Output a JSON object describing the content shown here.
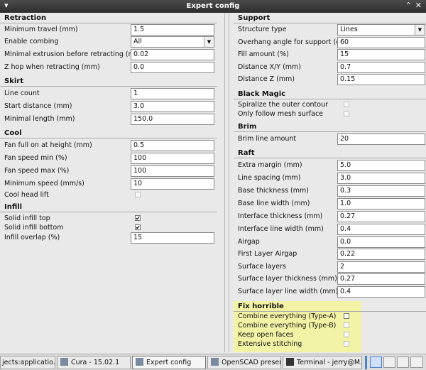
{
  "window": {
    "title": "Expert config",
    "menu_icon": "▾",
    "minimize": "⌃",
    "close": "✕"
  },
  "left": {
    "retraction": {
      "title": "Retraction",
      "min_travel_label": "Minimum travel (mm)",
      "min_travel": "1.5",
      "enable_combing_label": "Enable combing",
      "enable_combing": "All",
      "min_extrusion_label": "Minimal extrusion before retracting (mm)",
      "min_extrusion": "0.02",
      "z_hop_label": "Z hop when retracting (mm)",
      "z_hop": "0.0"
    },
    "skirt": {
      "title": "Skirt",
      "line_count_label": "Line count",
      "line_count": "1",
      "start_distance_label": "Start distance (mm)",
      "start_distance": "3.0",
      "min_length_label": "Minimal length (mm)",
      "min_length": "150.0"
    },
    "cool": {
      "title": "Cool",
      "fan_full_label": "Fan full on at height (mm)",
      "fan_full": "0.5",
      "fan_min_label": "Fan speed min (%)",
      "fan_min": "100",
      "fan_max_label": "Fan speed max (%)",
      "fan_max": "100",
      "min_speed_label": "Minimum speed (mm/s)",
      "min_speed": "10",
      "cool_head_lift_label": "Cool head lift"
    },
    "infill": {
      "title": "Infill",
      "solid_top_label": "Solid infill top",
      "solid_bottom_label": "Solid infill bottom",
      "overlap_label": "Infill overlap (%)",
      "overlap": "15"
    }
  },
  "right": {
    "support": {
      "title": "Support",
      "structure_type_label": "Structure type",
      "structure_type": "Lines",
      "overhang_label": "Overhang angle for support (deg)",
      "overhang": "60",
      "fill_label": "Fill amount (%)",
      "fill": "15",
      "dist_xy_label": "Distance X/Y (mm)",
      "dist_xy": "0.7",
      "dist_z_label": "Distance Z (mm)",
      "dist_z": "0.15"
    },
    "black_magic": {
      "title": "Black Magic",
      "spiralize_label": "Spiralize the outer contour",
      "mesh_surface_label": "Only follow mesh surface"
    },
    "brim": {
      "title": "Brim",
      "amount_label": "Brim line amount",
      "amount": "20"
    },
    "raft": {
      "title": "Raft",
      "extra_margin_label": "Extra margin (mm)",
      "extra_margin": "5.0",
      "line_spacing_label": "Line spacing (mm)",
      "line_spacing": "3.0",
      "base_thickness_label": "Base thickness (mm)",
      "base_thickness": "0.3",
      "base_line_width_label": "Base line width (mm)",
      "base_line_width": "1.0",
      "interface_thickness_label": "Interface thickness (mm)",
      "interface_thickness": "0.27",
      "interface_line_width_label": "Interface line width (mm)",
      "interface_line_width": "0.4",
      "airgap_label": "Airgap",
      "airgap": "0.0",
      "first_layer_airgap_label": "First Layer Airgap",
      "first_layer_airgap": "0.22",
      "surface_layers_label": "Surface layers",
      "surface_layers": "2",
      "surface_thickness_label": "Surface layer thickness (mm)",
      "surface_thickness": "0.27",
      "surface_line_width_label": "Surface layer line width (mm)",
      "surface_line_width": "0.4"
    },
    "fix_horrible": {
      "title": "Fix horrible",
      "combine_a_label": "Combine everything (Type-A)",
      "combine_b_label": "Combine everything (Type-B)",
      "keep_open_label": "Keep open faces",
      "extensive_label": "Extensive stitching"
    }
  },
  "checks": {
    "on": "✔"
  },
  "taskbar": {
    "item1": "jects:applicatio...",
    "item2": "Cura - 15.02.1",
    "item3": "Expert config",
    "item4": "OpenSCAD present...",
    "item5": "Terminal - jerry@M..."
  },
  "colors": {
    "highlight": "#f3f3a6",
    "titlebar": "#3a3a3a"
  }
}
